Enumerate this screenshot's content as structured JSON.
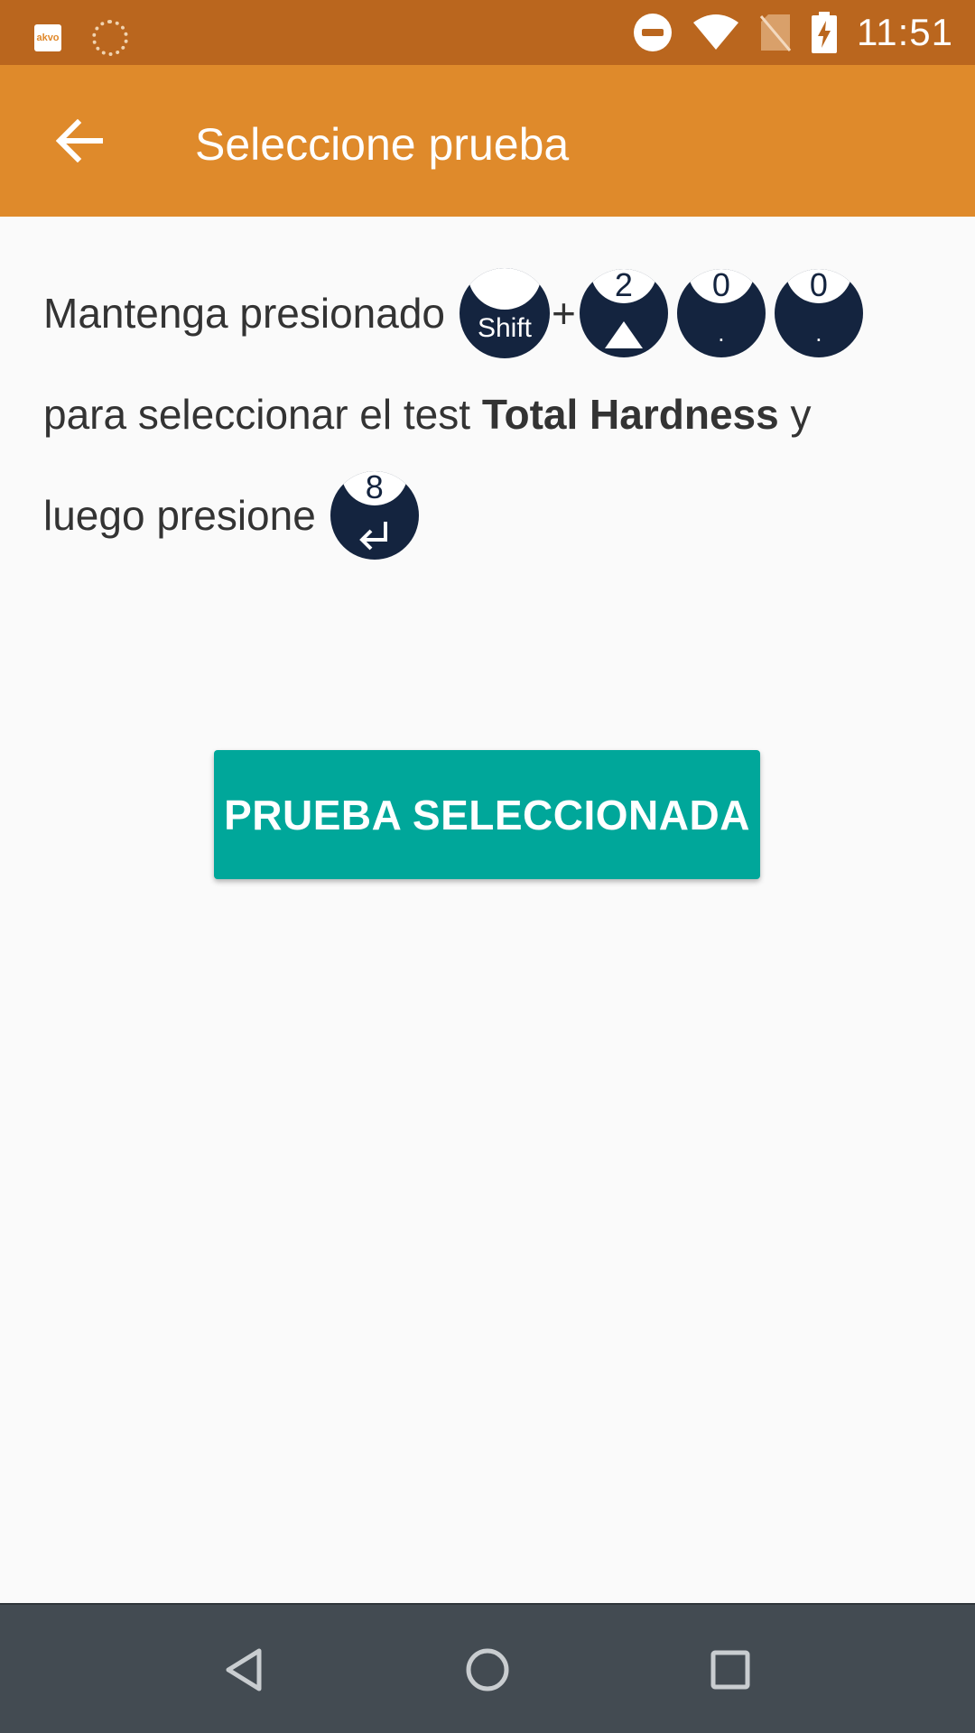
{
  "status_bar": {
    "time": "11:51",
    "app_icon_label": "akvo",
    "icons": [
      "akvo-notification-icon",
      "loading-notification-icon",
      "do-not-disturb-icon",
      "wifi-icon",
      "no-sim-icon",
      "battery-charging-icon"
    ]
  },
  "app_bar": {
    "title": "Seleccione prueba",
    "back_icon": "arrow-back-icon"
  },
  "instruction": {
    "line1_text": "Mantenga presionado",
    "plus": "+",
    "line2_text_before": "para seleccionar el test ",
    "line2_bold": "Total Hardness",
    "line2_text_after": " y",
    "line3_text": "luego presione",
    "keys": {
      "shift_label": "Shift",
      "key_2_top": "2",
      "key_0a_top": "0",
      "key_0a_sub": ".",
      "key_0b_top": "0",
      "key_0b_sub": ".",
      "key_8_top": "8"
    }
  },
  "primary_button": {
    "label": "PRUEBA SELECCIONADA"
  },
  "nav_bar": {
    "icons": [
      "back-triangle-icon",
      "home-circle-icon",
      "recents-square-icon"
    ]
  },
  "colors": {
    "status_bar": "#BA661E",
    "app_bar": "#DF8A2B",
    "button": "#00A79A",
    "key": "#14243F",
    "nav_bar": "#434B52"
  }
}
